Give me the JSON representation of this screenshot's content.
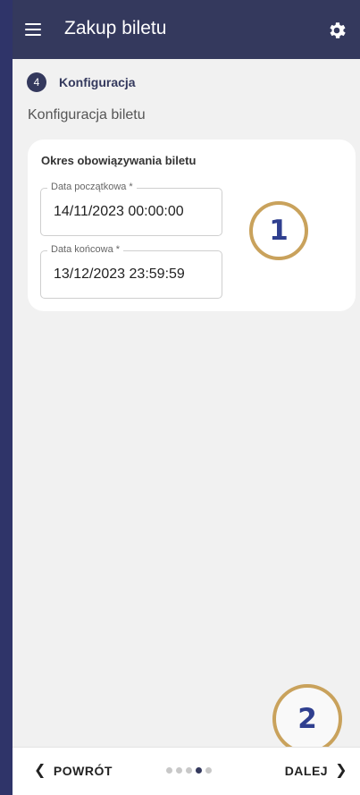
{
  "appbar": {
    "title": "Zakup biletu"
  },
  "step": {
    "number": "4",
    "label": "Konfiguracja"
  },
  "section_title": "Konfiguracja biletu",
  "card": {
    "title": "Okres obowiązywania biletu",
    "start_label": "Data początkowa *",
    "start_value": "14/11/2023 00:00:00",
    "end_label": "Data końcowa *",
    "end_value": "13/12/2023 23:59:59"
  },
  "markers": {
    "one": "1",
    "two": "2"
  },
  "bottom": {
    "back_label": "POWRÓT",
    "next_label": "DALEJ",
    "current_step": 4,
    "total_steps": 5
  },
  "colors": {
    "primary": "#34395d",
    "marker_ring": "#c9a25c",
    "marker_text": "#2f3f8f"
  },
  "icons": {
    "menu": "hamburger-icon",
    "settings": "gear-icon",
    "back": "chevron-left-icon",
    "next": "chevron-right-icon"
  }
}
